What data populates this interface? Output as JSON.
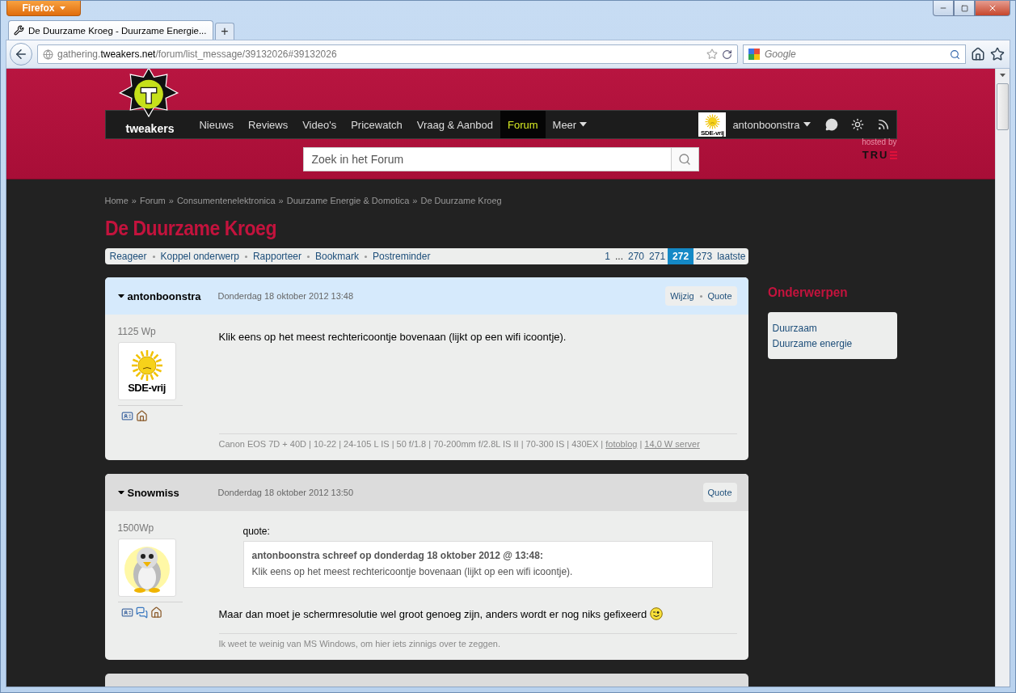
{
  "browser": {
    "app_button": "Firefox",
    "tab_title": "De Duurzame Kroeg - Duurzame Energie...",
    "new_tab": "+",
    "url": "gathering.**tweakers.net**/forum/list_message/39132026#39132026",
    "search_placeholder": "Google"
  },
  "site": {
    "logo_text": "tweakers",
    "nav": [
      {
        "label": "Nieuws",
        "selected": false
      },
      {
        "label": "Reviews",
        "selected": false
      },
      {
        "label": "Video's",
        "selected": false
      },
      {
        "label": "Pricewatch",
        "selected": false
      },
      {
        "label": "Vraag & Aanbod",
        "selected": false
      },
      {
        "label": "Forum",
        "selected": true
      },
      {
        "label": "Meer",
        "selected": false,
        "dropdown": true
      }
    ],
    "user": {
      "badge": "SDE-vrij",
      "name": "antonboonstra"
    },
    "search_placeholder": "Zoek in het Forum",
    "hosted_by": "hosted by",
    "host_logo": "TRU"
  },
  "breadcrumbs": {
    "separator": "»",
    "items": [
      "Home",
      "Forum",
      "Consumentenelektronica",
      "Duurzame Energie & Domotica",
      "De Duurzame Kroeg"
    ]
  },
  "title": "De Duurzame Kroeg",
  "actions": [
    "Reageer",
    "Koppel onderwerp",
    "Rapporteer",
    "Bookmark",
    "Postreminder"
  ],
  "pages": [
    {
      "label": "1",
      "kind": "link",
      "selected": false
    },
    {
      "label": "...",
      "kind": "gap",
      "selected": false
    },
    {
      "label": "270",
      "kind": "link",
      "selected": false
    },
    {
      "label": "271",
      "kind": "link",
      "selected": false
    },
    {
      "label": "272",
      "kind": "link",
      "selected": true
    },
    {
      "label": "273",
      "kind": "link",
      "selected": false
    },
    {
      "label": "laatste",
      "kind": "link",
      "selected": false
    }
  ],
  "posts": [
    {
      "author": "antonboonstra",
      "own": true,
      "date": "Donderdag 18 oktober 2012 13:48",
      "buttons": [
        "Wijzig",
        "Quote"
      ],
      "rating": "1125 Wp",
      "avatar": {
        "kind": "sun",
        "text": "SDE-vrij"
      },
      "profile_icons": [
        {
          "kind": "card"
        },
        {
          "kind": "home"
        }
      ],
      "body": "Klik eens op het meest rechtericoontje bovenaan (lijkt op een wifi icoontje).",
      "signature": [
        {
          "text": "Canon EOS 7D + 40D | 10-22 | 24-105 L IS | 50 f/1.8 | 70-200mm f/2.8L IS II | 70-300 IS | 430EX | ",
          "link": false
        },
        {
          "text": "fotoblog",
          "link": true
        },
        {
          "text": " | ",
          "link": false
        },
        {
          "text": "14,0 W server",
          "link": true
        }
      ]
    },
    {
      "author": "Snowmiss",
      "own": false,
      "date": "Donderdag 18 oktober 2012 13:50",
      "buttons": [
        "Quote"
      ],
      "rating": "1500Wp",
      "avatar": {
        "kind": "penguin"
      },
      "profile_icons": [
        {
          "kind": "card"
        },
        {
          "kind": "chat"
        },
        {
          "kind": "home"
        }
      ],
      "quote": {
        "label": "quote:",
        "header": "antonboonstra schreef op donderdag 18 oktober 2012 @ 13:48:",
        "text": "Klik eens op het meest rechtericoontje bovenaan (lijkt op een wifi icoontje)."
      },
      "body": "Maar dan moet je schermresolutie wel groot genoeg zijn, anders wordt er nog niks gefixeerd",
      "emoticon": true,
      "signature": [
        {
          "text": "Ik weet te weinig van MS Windows, om hier iets zinnigs over te zeggen.",
          "link": false
        }
      ]
    }
  ],
  "sidebar": {
    "heading": "Onderwerpen",
    "links": [
      "Duurzaam",
      "Duurzame energie"
    ]
  }
}
